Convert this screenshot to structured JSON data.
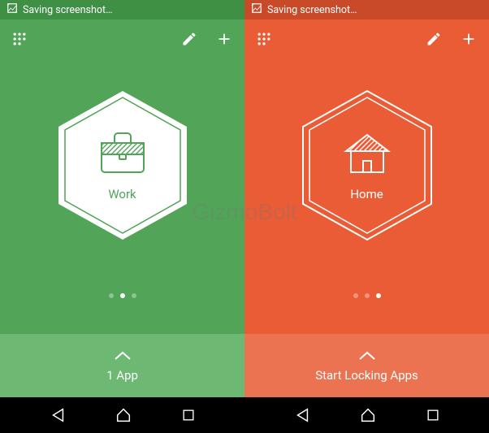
{
  "statusbar": {
    "saving_text": "Saving screenshot…"
  },
  "left": {
    "badge_label": "Work",
    "footer_label": "1 App",
    "page_index": 1,
    "page_count": 3,
    "bg_color": "#52a458",
    "statusbar_color": "#3f8f45",
    "footer_color": "#6db872",
    "icon": "briefcase-icon"
  },
  "right": {
    "badge_label": "Home",
    "footer_label": "Start Locking Apps",
    "page_index": 2,
    "page_count": 3,
    "bg_color": "#e95c36",
    "statusbar_color": "#c94a28",
    "footer_color": "#ec7351",
    "icon": "house-icon"
  },
  "watermark": "GizmoBolt"
}
